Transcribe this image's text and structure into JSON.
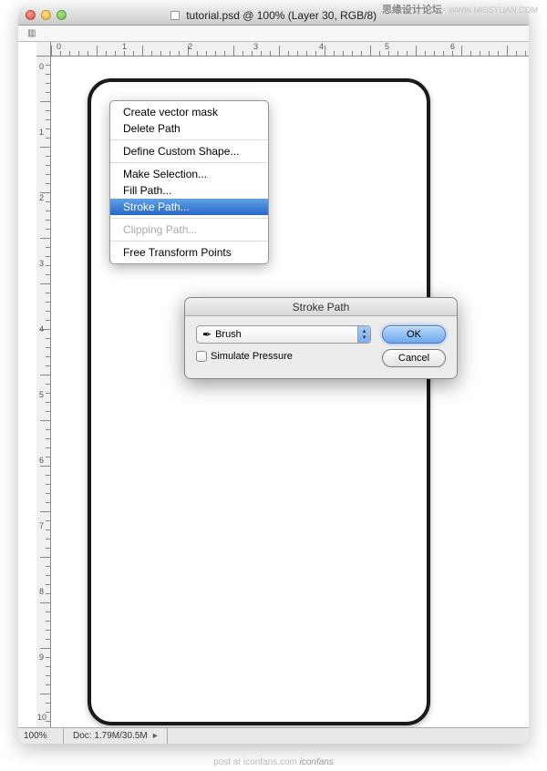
{
  "watermark": {
    "text": "思缘设计论坛",
    "url": "WWW.MISSYUAN.COM"
  },
  "window": {
    "title": "tutorial.psd @ 100% (Layer 30, RGB/8)"
  },
  "ruler_h": [
    "0",
    "1",
    "2",
    "3",
    "4",
    "5",
    "6"
  ],
  "ruler_v": [
    "0",
    "1",
    "2",
    "3",
    "4",
    "5",
    "6",
    "7",
    "8",
    "9",
    "10"
  ],
  "menu": {
    "items": [
      {
        "label": "Create vector mask",
        "disabled": false
      },
      {
        "label": "Delete Path",
        "disabled": false
      },
      {
        "label": "Define Custom Shape...",
        "disabled": false
      },
      {
        "label": "Make Selection...",
        "disabled": false
      },
      {
        "label": "Fill Path...",
        "disabled": false
      },
      {
        "label": "Stroke Path...",
        "disabled": false,
        "highlighted": true
      },
      {
        "label": "Clipping Path...",
        "disabled": true
      },
      {
        "label": "Free Transform Points",
        "disabled": false
      }
    ]
  },
  "dialog": {
    "title": "Stroke Path",
    "tool": "Brush",
    "simulate_label": "Simulate Pressure",
    "ok": "OK",
    "cancel": "Cancel"
  },
  "status": {
    "zoom": "100%",
    "doc": "Doc: 1.79M/30.5M"
  },
  "footer": {
    "label": "post at",
    "site": "iconfans.com",
    "brand": "iconfans"
  }
}
